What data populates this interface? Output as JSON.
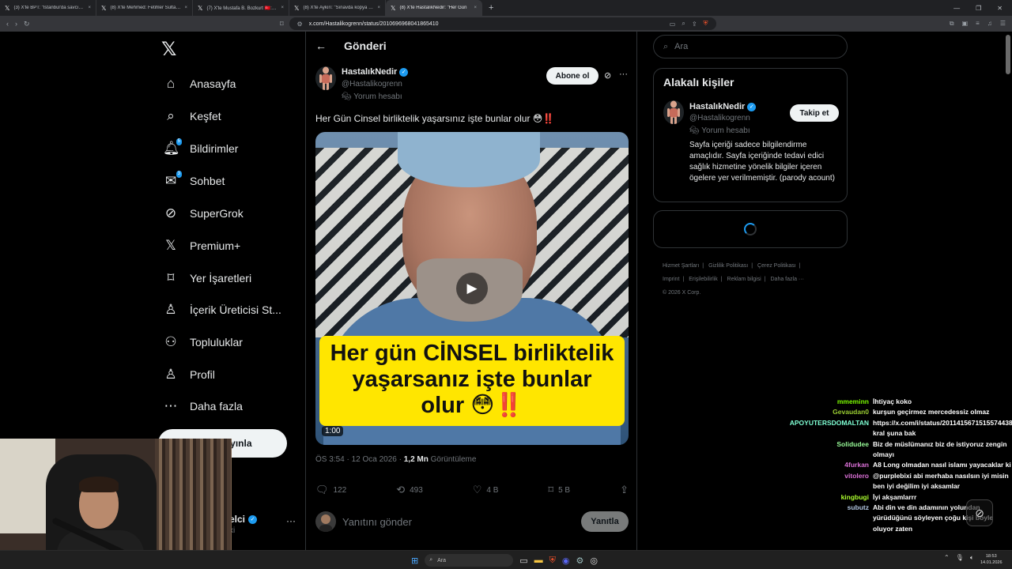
{
  "browser": {
    "tabs": [
      {
        "title": "(3) X'te BPT: \"İstanbul'da savcının hal",
        "active": false
      },
      {
        "title": "(8) X'te Mehmed: Fetihler Sultanı \"O",
        "active": false
      },
      {
        "title": "(7) X'te Mustafa B. Bozkurt 🇹🇷: \"Sigo",
        "active": false
      },
      {
        "title": "(8) X'te Aykırı: \"Sınavda kopya çekme",
        "active": false
      },
      {
        "title": "(8) X'te HastalıkNedir: \"Her Gün",
        "active": true
      }
    ],
    "url": "x.com/Hastalikogrenn/status/2010696968041865410"
  },
  "nav": {
    "items": [
      {
        "label": "Anasayfa",
        "icon": "home-icon",
        "glyph": "⌂"
      },
      {
        "label": "Keşfet",
        "icon": "search-icon",
        "glyph": "⌕"
      },
      {
        "label": "Bildirimler",
        "icon": "bell-icon",
        "glyph": "🔔︎",
        "badge": "5"
      },
      {
        "label": "Sohbet",
        "icon": "mail-icon",
        "glyph": "✉",
        "badge": "3"
      },
      {
        "label": "SuperGrok",
        "icon": "grok-icon",
        "glyph": "⊘"
      },
      {
        "label": "Premium+",
        "icon": "x-logo-icon",
        "glyph": "𝕏"
      },
      {
        "label": "Yer İşaretleri",
        "icon": "bookmark-icon",
        "glyph": "⌑"
      },
      {
        "label": "İçerik Üreticisi St...",
        "icon": "creator-studio-icon",
        "glyph": "♙"
      },
      {
        "label": "Topluluklar",
        "icon": "communities-icon",
        "glyph": "⚇"
      },
      {
        "label": "Profil",
        "icon": "profile-icon",
        "glyph": "♙"
      },
      {
        "label": "Daha fazla",
        "icon": "more-circle-icon",
        "glyph": "⋯"
      }
    ],
    "post_button": "ayınla",
    "account_name": "elci",
    "account_handle": "xi"
  },
  "main": {
    "header_title": "Gönderi",
    "author_name": "HastalıkNedir",
    "author_handle": "@Hastalikogrenn",
    "author_label": "Yorum hesabı",
    "subscribe_label": "Abone ol",
    "post_text": "Her Gün Cinsel birliktelik yaşarsınız işte bunlar olur 😳",
    "post_text_suffix": "‼️",
    "video_caption_line1": "Her gün CİNSEL birliktelik",
    "video_caption_line2": "yaşarsanız işte bunlar",
    "video_caption_line3": "olur 😳",
    "video_caption_suffix": "‼️",
    "video_duration": "1:00",
    "timestamp": "ÖS 3:54 · 12 Oca 2026 · ",
    "views_count": "1,2 Mn",
    "views_label": " Görüntüleme",
    "stats": {
      "replies": "122",
      "reposts": "493",
      "likes": "4 B",
      "bookmarks": "5 B"
    },
    "reply_placeholder": "Yanıtını gönder",
    "reply_button": "Yanıtla"
  },
  "sidebar": {
    "search_placeholder": "Ara",
    "related_title": "Alakalı kişiler",
    "related_name": "HastalıkNedir",
    "related_handle": "@Hastalikogrenn",
    "related_label": "Yorum hesabı",
    "related_bio": "Sayfa içeriği sadece bilgilendirme amaçlıdır. Sayfa içeriğinde tedavi edici sağlık hizmetine yönelik bilgiler içeren ögelere yer verilmemiştir. (parody acount)",
    "follow_label": "Takip et",
    "footer_links": [
      "Hizmet Şartları",
      "Gizlilik Politikası",
      "Çerez Politikası",
      "Imprint",
      "Erişilebilirlik",
      "Reklam bilgisi",
      "Daha fazla ···"
    ],
    "copyright": "© 2026 X Corp."
  },
  "chat": [
    {
      "user": "mmeminn",
      "color": "#7cfc00",
      "text": "İhtiyaç koko"
    },
    {
      "user": "Gevaudan0",
      "color": "#9acd32",
      "text": "kurşun geçirmez mercedessiz olmaz"
    },
    {
      "user": "APOYUTERSDOMALTAN",
      "color": "#7fffd4",
      "text": "https://x.com/i/status/2011415671515574438 kral şuna bak"
    },
    {
      "user": "Solidudee",
      "color": "#98fb98",
      "text": "Biz de müslümanız biz de istiyoruz zengin olmayı"
    },
    {
      "user": "4furkan",
      "color": "#da70d6",
      "text": "A8 Long olmadan nasıl islamı yayacaklar ki"
    },
    {
      "user": "vitolero",
      "color": "#da70d6",
      "text": "@purplebixi abi merhaba nasılsın iyi misin ben iyi değilim iyi aksamlar"
    },
    {
      "user": "kingbugi",
      "color": "#adff2f",
      "text": "İyi akşamlarrr"
    },
    {
      "user": "subutz",
      "color": "#b0c4de",
      "text": "Abi din ve din adamının yolundan yürüdüğünü söyleyen çoğu kişi böyle oluyor zaten"
    }
  ],
  "taskbar": {
    "search_placeholder": "Ara",
    "time": "18:53",
    "date": "14.01.2026"
  },
  "colors": {
    "accent": "#1d9bf0",
    "background": "#000000",
    "border": "#2f3336",
    "muted": "#71767b"
  }
}
